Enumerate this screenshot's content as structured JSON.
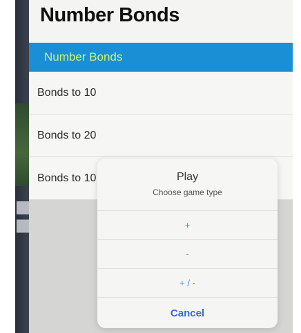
{
  "panel": {
    "title": "Number Bonds"
  },
  "list": {
    "header": "Number Bonds",
    "items": [
      "Bonds to 10",
      "Bonds to 20",
      "Bonds to 10"
    ]
  },
  "dialog": {
    "title": "Play",
    "subtitle": "Choose game type",
    "options": [
      "+",
      "-",
      "+ / -"
    ],
    "cancel": "Cancel"
  },
  "colors": {
    "header_bg": "#1a8fd6",
    "header_text": "#d8f06a",
    "option_text": "#4a90e2"
  }
}
